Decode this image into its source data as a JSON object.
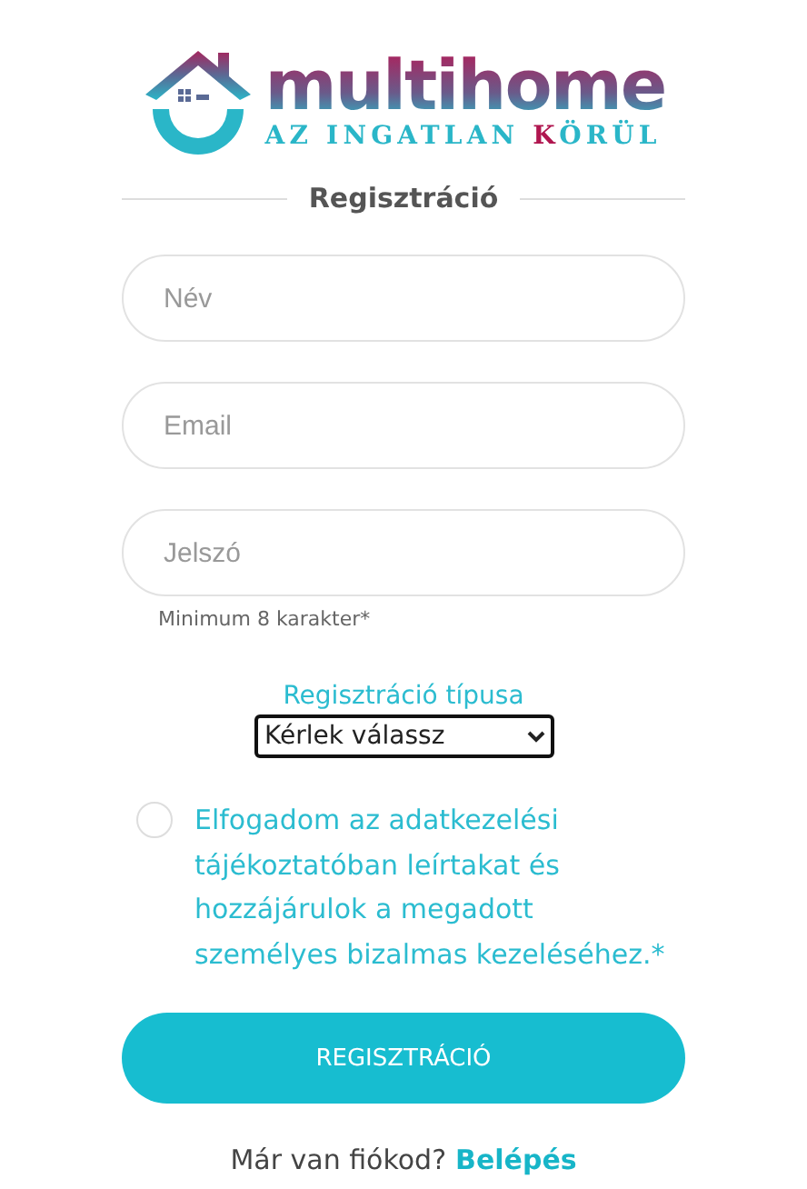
{
  "logo": {
    "name": "multihome",
    "tagline": [
      {
        "text": "AZ INGATLAN ",
        "accent": false
      },
      {
        "text": "K",
        "accent": true
      },
      {
        "text": "ÖRÜL",
        "accent": false
      }
    ]
  },
  "form_title": "Regisztráció",
  "fields": [
    {
      "placeholder": "Név"
    },
    {
      "placeholder": "Email"
    },
    {
      "placeholder": "Jelszó",
      "hint": "Minimum 8 karakter*"
    }
  ],
  "registration_type": {
    "label": "Regisztráció típusa",
    "value": "Kérlek válassz"
  },
  "consent": {
    "checked": false,
    "text": "Elfogadom az adatkezelési tájékoztatóban leírtakat és hozzájárulok a megadott személyes bizalmas kezeléséhez.*"
  },
  "submit_button": "REGISZTRÁCIÓ",
  "footer": {
    "text": "Már van fiókod?",
    "link": "Belépés"
  }
}
